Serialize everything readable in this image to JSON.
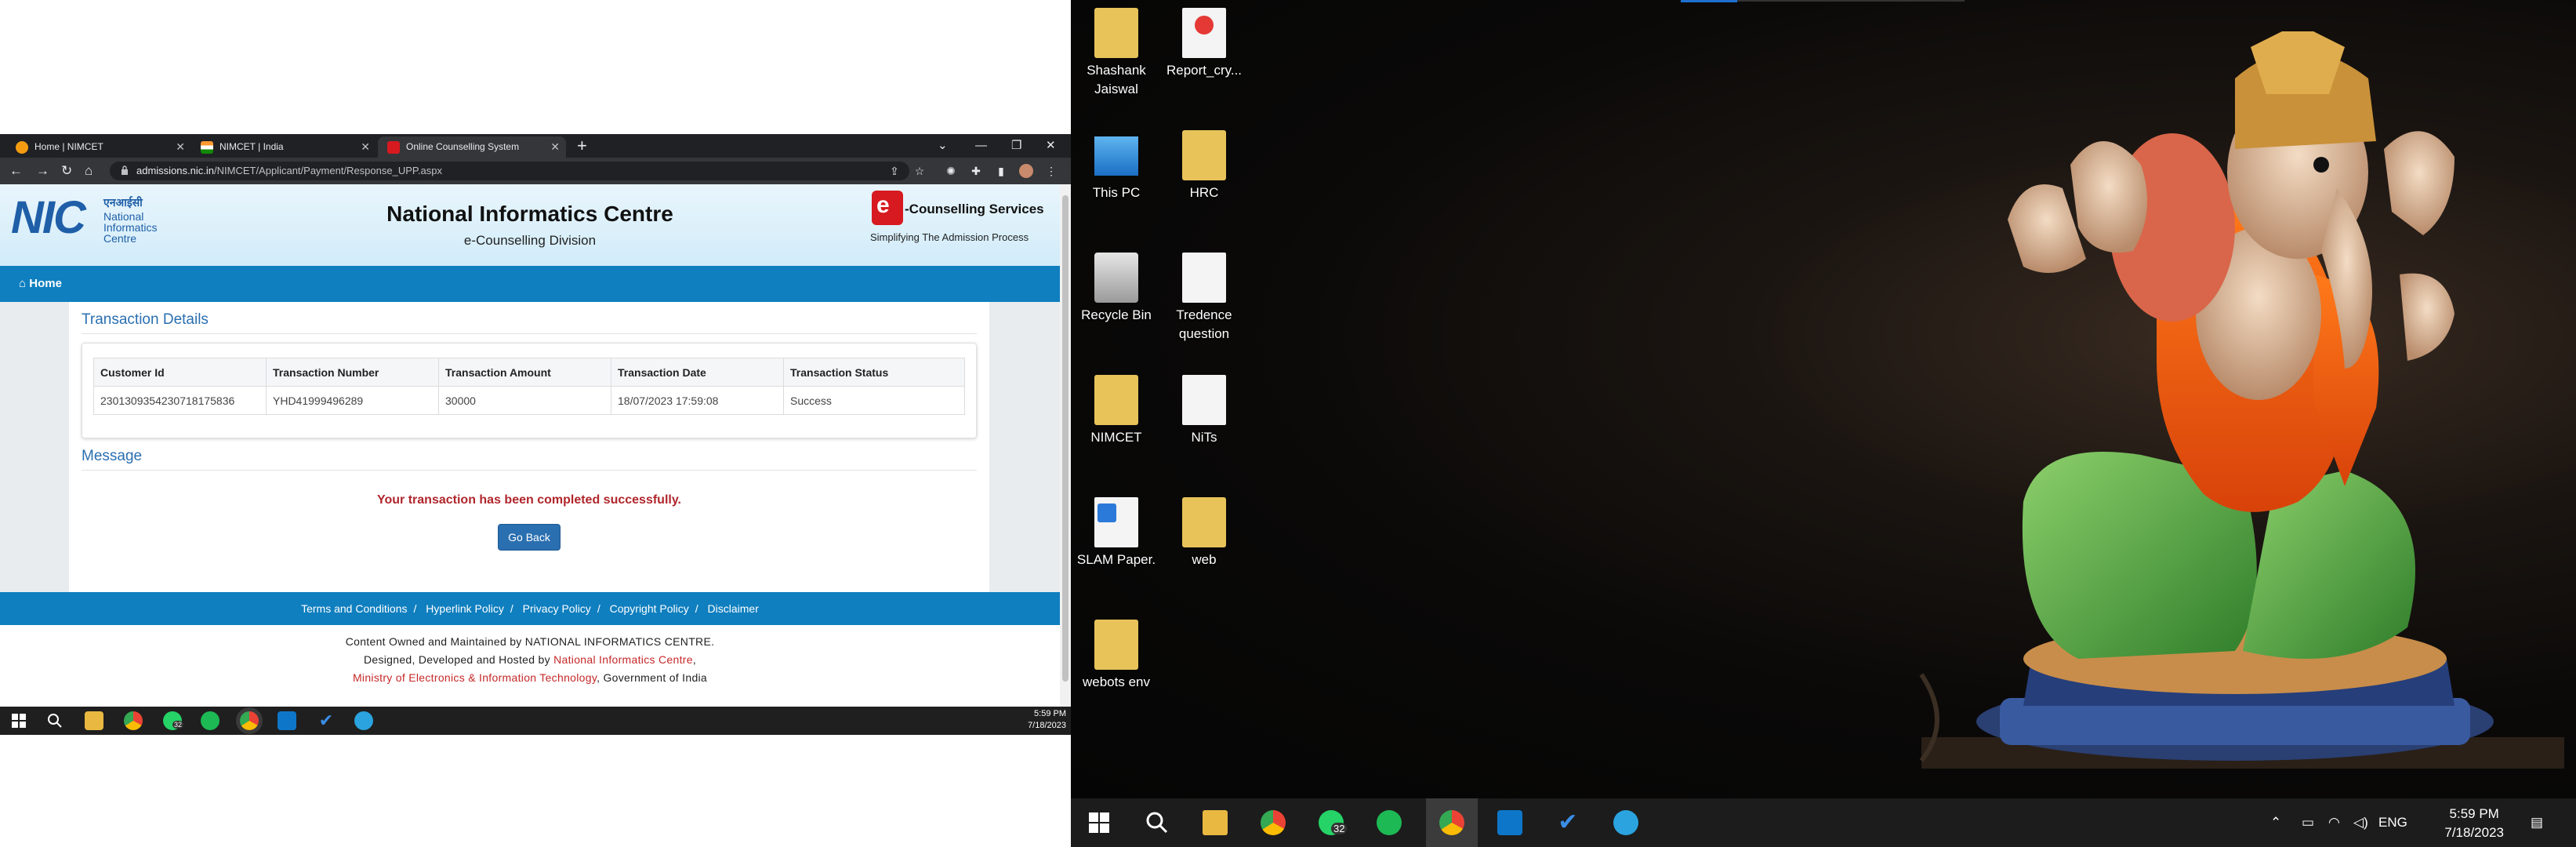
{
  "browser": {
    "tabs": [
      {
        "label": "Home | NIMCET",
        "active": false
      },
      {
        "label": "NIMCET | India",
        "active": false
      },
      {
        "label": "Online Counselling System",
        "active": true
      }
    ],
    "url_host": "admissions.nic.in",
    "url_path": "/NIMCET/Applicant/Payment/Response_UPP.aspx"
  },
  "header": {
    "logo_text": "NIC",
    "logo_hindi": "एनआईसी",
    "logo_sub": "National Informatics Centre",
    "title": "National Informatics Centre",
    "subtitle": "e-Counselling Division",
    "brand_logo_letter": "e",
    "brand_title": "-Counselling Services",
    "brand_tagline": "Simplifying The Admission Process"
  },
  "nav": {
    "home_label": "Home"
  },
  "transaction": {
    "section_title": "Transaction Details",
    "columns": [
      "Customer Id",
      "Transaction Number",
      "Transaction Amount",
      "Transaction Date",
      "Transaction Status"
    ],
    "row": [
      "230130935423071817583​6",
      "YHD41999496289",
      "30000",
      "18/07/2023 17:59:08",
      "Success"
    ]
  },
  "message": {
    "section_title": "Message",
    "text": "Your transaction has been completed successfully.",
    "button_label": "Go Back"
  },
  "footer": {
    "links": [
      "Terms and Conditions",
      "Hyperlink Policy",
      "Privacy Policy",
      "Copyright Policy",
      "Disclaimer"
    ],
    "line1": "Content Owned and Maintained by NATIONAL INFORMATICS CENTRE.",
    "line2_prefix": "Designed, Developed and Hosted by ",
    "line2_link": "National Informatics Centre",
    "line2_suffix": ",",
    "line3_link": "Ministry of Electronics & Information Technology",
    "line3_suffix": ", Government of India"
  },
  "left_taskbar": {
    "whatsapp_badge": "32",
    "time": "5:59 PM",
    "date": "7/18/2023"
  },
  "desktop": {
    "icons": [
      {
        "label": "Shashank Jaiswal",
        "type": "user-folder"
      },
      {
        "label": "Report_cry...",
        "type": "pdf"
      },
      {
        "label": "This PC",
        "type": "pc"
      },
      {
        "label": "HRC",
        "type": "folder"
      },
      {
        "label": "Recycle Bin",
        "type": "recycle"
      },
      {
        "label": "Tredence question",
        "type": "doc"
      },
      {
        "label": "NIMCET",
        "type": "folder"
      },
      {
        "label": "NiTs",
        "type": "doc"
      },
      {
        "label": "SLAM Paper.",
        "type": "word"
      },
      {
        "label": "web",
        "type": "folder"
      },
      {
        "label": "webots env",
        "type": "folder"
      }
    ]
  },
  "right_taskbar": {
    "whatsapp_badge": "32",
    "language": "ENG",
    "time": "5:59 PM",
    "date": "7/18/2023"
  },
  "colors": {
    "nic_blue": "#0f7fbf",
    "title_blue": "#2a6fb0",
    "success_red": "#b0262c",
    "chrome_dark": "#35363a"
  }
}
